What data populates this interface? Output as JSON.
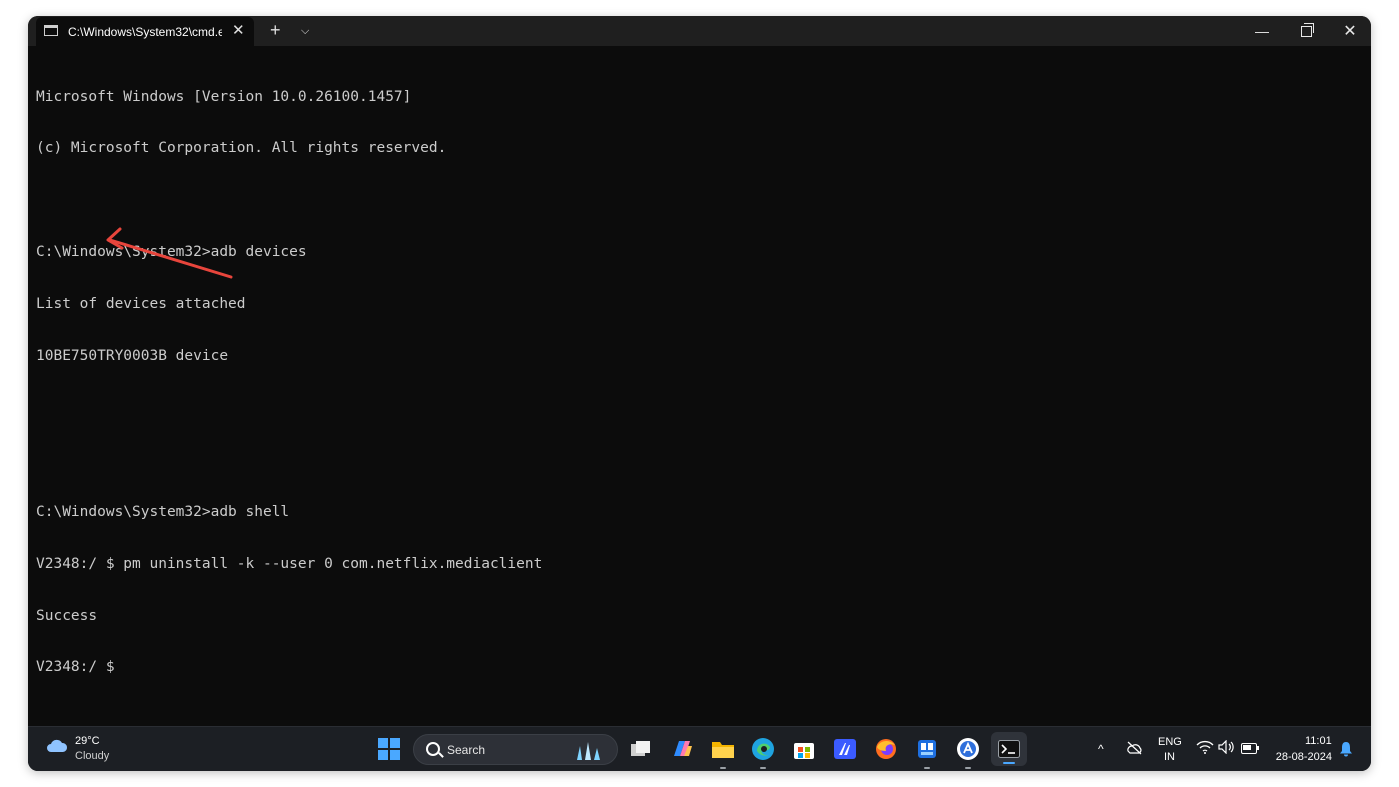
{
  "window": {
    "tab_title": "C:\\Windows\\System32\\cmd.e",
    "tab_close": "✕",
    "new_tab": "+",
    "tab_dropdown": "⌵",
    "minimize": "—",
    "close": "✕"
  },
  "terminal": {
    "lines": [
      "Microsoft Windows [Version 10.0.26100.1457]",
      "(c) Microsoft Corporation. All rights reserved.",
      "",
      "C:\\Windows\\System32>adb devices",
      "List of devices attached",
      "10BE750TRY0003B device",
      "",
      "",
      "C:\\Windows\\System32>adb shell",
      "V2348:/ $ pm uninstall -k --user 0 com.netflix.mediaclient",
      "Success",
      "V2348:/ $"
    ]
  },
  "annotation": {
    "arrow_color": "#e8453c",
    "arrow_target": "success-line"
  },
  "taskbar": {
    "weather": {
      "temp": "29°C",
      "condition": "Cloudy",
      "icon": "cloud-icon"
    },
    "search": {
      "label": "Search"
    },
    "apps": [
      "task-view-icon",
      "copilot-icon",
      "file-explorer-icon",
      "edge-icon",
      "microsoft-store-icon",
      "canva-icon",
      "firefox-icon",
      "system-monitor-icon",
      "app-store-icon",
      "terminal-icon"
    ],
    "tray": {
      "chevron": "^",
      "lang_top": "ENG",
      "lang_bottom": "IN",
      "time": "11:01",
      "date": "28-08-2024"
    }
  },
  "colors": {
    "terminal_bg": "#0c0c0c",
    "terminal_fg": "#cccccc",
    "titlebar_bg": "#1f1f1f",
    "taskbar_bg": "#1c1f24",
    "accent": "#4aa8ff"
  }
}
